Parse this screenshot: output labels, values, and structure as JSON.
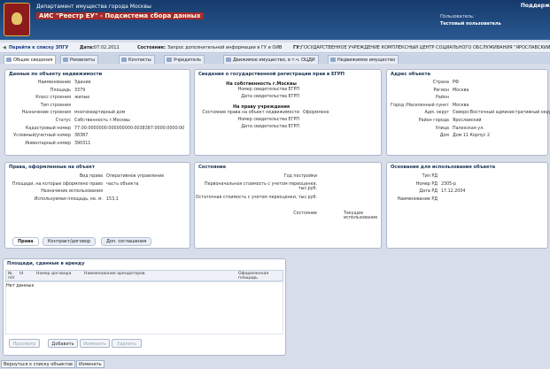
{
  "header": {
    "line1": "Департамент имущества города Москвы",
    "line2": "АИС \"Реестр ЕУ\" - Подсистема сбора данных",
    "right_label": "Поддерж",
    "user_label": "Пользователь:",
    "user_name": "Тестовый пользователь"
  },
  "toolbar": {
    "back_link": "Перейти к списку ЗПГУ",
    "date_label": "Дата:",
    "date_value": "07.02.2012",
    "state_label": "Состояние:",
    "state_value": "Запрос дополнительной информации в ГУ и ОИВ",
    "org_label": "ГУ:",
    "org_value": "ГОСУДАРСТВЕННОЕ УЧРЕЖДЕНИЕ КОМПЛЕКСНЫЙ ЦЕНТР СОЦИАЛЬНОГО ОБСЛУЖИВАНИЯ \"ЯРОСЛАВСКИЙ\""
  },
  "tabs": [
    "Общие сведения",
    "Реквизиты",
    "Контакты",
    "Учредитель",
    "Движимое имущество, в т.ч. ОЦДИ",
    "Недвижимое имущество"
  ],
  "object_data": {
    "title": "Данные по объекту недвижимости",
    "rows": [
      {
        "k": "Наименование",
        "v": "Здание"
      },
      {
        "k": "Площадь",
        "v": "3379"
      },
      {
        "k": "Класс строения",
        "v": "жилые"
      },
      {
        "k": "Тип строения",
        "v": ""
      },
      {
        "k": "Назначение строения",
        "v": "многоквартирный дом"
      },
      {
        "k": "Статус",
        "v": "Собственность г.Москвы"
      },
      {
        "k": "Кадастровый номер",
        "v": "77:00:0000000:000000000:0038387:0000:0000:00"
      },
      {
        "k": "Условный/учетный номер",
        "v": "38387"
      },
      {
        "k": "Инвентарный номер",
        "v": "390311"
      }
    ]
  },
  "egrp": {
    "title": "Сведения о государственной регистрации прав в ЕГРП",
    "ownership_heading": "На собственность г.Москвы",
    "rows1": [
      {
        "k": "Номер свидетельства ЕГРП",
        "v": ""
      },
      {
        "k": "Дата свидетельства ЕГРП",
        "v": ""
      }
    ],
    "institution_heading": "На праву учреждения",
    "rows2": [
      {
        "k": "Состояние права на объект недвижимости",
        "v": "Оформлено"
      },
      {
        "k": "Номер свидетельства ЕГРП",
        "v": ""
      },
      {
        "k": "Дата свидетельства ЕГРП",
        "v": ""
      }
    ]
  },
  "address": {
    "title": "Адрес объекта",
    "rows": [
      {
        "k": "Страна",
        "v": "РФ"
      },
      {
        "k": "Регион",
        "v": "Москва"
      },
      {
        "k": "Район",
        "v": ""
      },
      {
        "k": "Город /Населенный пункт",
        "v": "Москва"
      },
      {
        "k": "Адм. округ",
        "v": "Северо-Восточный административный округ"
      },
      {
        "k": "Район города",
        "v": "Ярославский"
      },
      {
        "k": "Улица",
        "v": "Палехская ул."
      },
      {
        "k": "Дом",
        "v": "Дом 11 Корпус 2"
      }
    ]
  },
  "rights": {
    "title": "Права, оформленные на объект",
    "rows": [
      {
        "k": "Вид права",
        "v": "Оперативное управление"
      },
      {
        "k": "Площади, на которые оформлено право",
        "v": "часть объекта"
      },
      {
        "k": "Назначение использования",
        "v": ""
      },
      {
        "k": "Используемая площадь, кв. м.",
        "v": "153,1"
      }
    ],
    "subtabs": [
      "Права",
      "Контракт/договор",
      "Доп. соглашения"
    ]
  },
  "state": {
    "title": "Состояние",
    "rows": [
      {
        "k": "Год постройки",
        "v": ""
      },
      {
        "k": "Первоначальная стоимость с учетом переоценки, тыс.руб.",
        "v": ""
      },
      {
        "k": "Остаточная стоимость с учетом переоценки, тыс.руб.",
        "v": ""
      },
      {
        "k": "Состояние",
        "v": "Текущее использование"
      }
    ]
  },
  "basis": {
    "title": "Основания для использования объекта",
    "rows": [
      {
        "k": "Тип РД",
        "v": ""
      },
      {
        "k": "Номер РД",
        "v": "2305-р"
      },
      {
        "k": "Дата РД",
        "v": "17.12.2004"
      },
      {
        "k": "Наименование РД",
        "v": ""
      }
    ]
  },
  "lease": {
    "title": "Площади, сданные в аренду",
    "columns": [
      "№ п/п",
      "Id",
      "Номер договора",
      "Наименование арендаторов",
      "Оформленная площадь"
    ],
    "empty": "Нет данных",
    "buttons": [
      "Просмотр",
      "Добавить",
      "Изменить",
      "Удалить"
    ]
  },
  "bottom_tabs": [
    "Вернуться к списку объектов",
    "Изменить"
  ],
  "colors": {
    "header_bg": "#1f4a80",
    "accent_red": "#a52a2a",
    "panel_border": "#aeb9cc"
  }
}
